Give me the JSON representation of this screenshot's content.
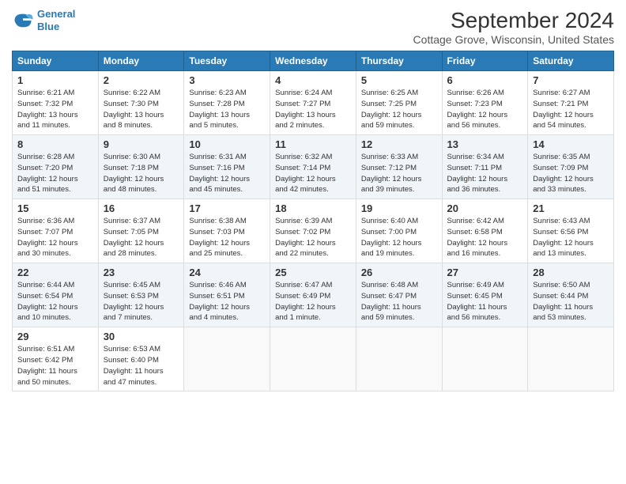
{
  "logo": {
    "line1": "General",
    "line2": "Blue"
  },
  "title": "September 2024",
  "subtitle": "Cottage Grove, Wisconsin, United States",
  "headers": [
    "Sunday",
    "Monday",
    "Tuesday",
    "Wednesday",
    "Thursday",
    "Friday",
    "Saturday"
  ],
  "weeks": [
    [
      {
        "day": "1",
        "lines": [
          "Sunrise: 6:21 AM",
          "Sunset: 7:32 PM",
          "Daylight: 13 hours",
          "and 11 minutes."
        ]
      },
      {
        "day": "2",
        "lines": [
          "Sunrise: 6:22 AM",
          "Sunset: 7:30 PM",
          "Daylight: 13 hours",
          "and 8 minutes."
        ]
      },
      {
        "day": "3",
        "lines": [
          "Sunrise: 6:23 AM",
          "Sunset: 7:28 PM",
          "Daylight: 13 hours",
          "and 5 minutes."
        ]
      },
      {
        "day": "4",
        "lines": [
          "Sunrise: 6:24 AM",
          "Sunset: 7:27 PM",
          "Daylight: 13 hours",
          "and 2 minutes."
        ]
      },
      {
        "day": "5",
        "lines": [
          "Sunrise: 6:25 AM",
          "Sunset: 7:25 PM",
          "Daylight: 12 hours",
          "and 59 minutes."
        ]
      },
      {
        "day": "6",
        "lines": [
          "Sunrise: 6:26 AM",
          "Sunset: 7:23 PM",
          "Daylight: 12 hours",
          "and 56 minutes."
        ]
      },
      {
        "day": "7",
        "lines": [
          "Sunrise: 6:27 AM",
          "Sunset: 7:21 PM",
          "Daylight: 12 hours",
          "and 54 minutes."
        ]
      }
    ],
    [
      {
        "day": "8",
        "lines": [
          "Sunrise: 6:28 AM",
          "Sunset: 7:20 PM",
          "Daylight: 12 hours",
          "and 51 minutes."
        ]
      },
      {
        "day": "9",
        "lines": [
          "Sunrise: 6:30 AM",
          "Sunset: 7:18 PM",
          "Daylight: 12 hours",
          "and 48 minutes."
        ]
      },
      {
        "day": "10",
        "lines": [
          "Sunrise: 6:31 AM",
          "Sunset: 7:16 PM",
          "Daylight: 12 hours",
          "and 45 minutes."
        ]
      },
      {
        "day": "11",
        "lines": [
          "Sunrise: 6:32 AM",
          "Sunset: 7:14 PM",
          "Daylight: 12 hours",
          "and 42 minutes."
        ]
      },
      {
        "day": "12",
        "lines": [
          "Sunrise: 6:33 AM",
          "Sunset: 7:12 PM",
          "Daylight: 12 hours",
          "and 39 minutes."
        ]
      },
      {
        "day": "13",
        "lines": [
          "Sunrise: 6:34 AM",
          "Sunset: 7:11 PM",
          "Daylight: 12 hours",
          "and 36 minutes."
        ]
      },
      {
        "day": "14",
        "lines": [
          "Sunrise: 6:35 AM",
          "Sunset: 7:09 PM",
          "Daylight: 12 hours",
          "and 33 minutes."
        ]
      }
    ],
    [
      {
        "day": "15",
        "lines": [
          "Sunrise: 6:36 AM",
          "Sunset: 7:07 PM",
          "Daylight: 12 hours",
          "and 30 minutes."
        ]
      },
      {
        "day": "16",
        "lines": [
          "Sunrise: 6:37 AM",
          "Sunset: 7:05 PM",
          "Daylight: 12 hours",
          "and 28 minutes."
        ]
      },
      {
        "day": "17",
        "lines": [
          "Sunrise: 6:38 AM",
          "Sunset: 7:03 PM",
          "Daylight: 12 hours",
          "and 25 minutes."
        ]
      },
      {
        "day": "18",
        "lines": [
          "Sunrise: 6:39 AM",
          "Sunset: 7:02 PM",
          "Daylight: 12 hours",
          "and 22 minutes."
        ]
      },
      {
        "day": "19",
        "lines": [
          "Sunrise: 6:40 AM",
          "Sunset: 7:00 PM",
          "Daylight: 12 hours",
          "and 19 minutes."
        ]
      },
      {
        "day": "20",
        "lines": [
          "Sunrise: 6:42 AM",
          "Sunset: 6:58 PM",
          "Daylight: 12 hours",
          "and 16 minutes."
        ]
      },
      {
        "day": "21",
        "lines": [
          "Sunrise: 6:43 AM",
          "Sunset: 6:56 PM",
          "Daylight: 12 hours",
          "and 13 minutes."
        ]
      }
    ],
    [
      {
        "day": "22",
        "lines": [
          "Sunrise: 6:44 AM",
          "Sunset: 6:54 PM",
          "Daylight: 12 hours",
          "and 10 minutes."
        ]
      },
      {
        "day": "23",
        "lines": [
          "Sunrise: 6:45 AM",
          "Sunset: 6:53 PM",
          "Daylight: 12 hours",
          "and 7 minutes."
        ]
      },
      {
        "day": "24",
        "lines": [
          "Sunrise: 6:46 AM",
          "Sunset: 6:51 PM",
          "Daylight: 12 hours",
          "and 4 minutes."
        ]
      },
      {
        "day": "25",
        "lines": [
          "Sunrise: 6:47 AM",
          "Sunset: 6:49 PM",
          "Daylight: 12 hours",
          "and 1 minute."
        ]
      },
      {
        "day": "26",
        "lines": [
          "Sunrise: 6:48 AM",
          "Sunset: 6:47 PM",
          "Daylight: 11 hours",
          "and 59 minutes."
        ]
      },
      {
        "day": "27",
        "lines": [
          "Sunrise: 6:49 AM",
          "Sunset: 6:45 PM",
          "Daylight: 11 hours",
          "and 56 minutes."
        ]
      },
      {
        "day": "28",
        "lines": [
          "Sunrise: 6:50 AM",
          "Sunset: 6:44 PM",
          "Daylight: 11 hours",
          "and 53 minutes."
        ]
      }
    ],
    [
      {
        "day": "29",
        "lines": [
          "Sunrise: 6:51 AM",
          "Sunset: 6:42 PM",
          "Daylight: 11 hours",
          "and 50 minutes."
        ]
      },
      {
        "day": "30",
        "lines": [
          "Sunrise: 6:53 AM",
          "Sunset: 6:40 PM",
          "Daylight: 11 hours",
          "and 47 minutes."
        ]
      },
      {
        "day": "",
        "lines": []
      },
      {
        "day": "",
        "lines": []
      },
      {
        "day": "",
        "lines": []
      },
      {
        "day": "",
        "lines": []
      },
      {
        "day": "",
        "lines": []
      }
    ]
  ]
}
